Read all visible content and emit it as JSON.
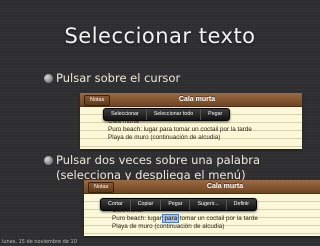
{
  "slide_title": "Seleccionar texto",
  "bullets": [
    {
      "text": "Pulsar sobre el cursor"
    },
    {
      "text": "Pulsar dos veces sobre una palabra (selecciona y despliega el menú)"
    }
  ],
  "screenshot1": {
    "notes_button": "Notas",
    "note_title": "Cala murta",
    "menu": [
      "Seleccionar",
      "Seleccionar todo",
      "Pegar"
    ],
    "lines": [
      "Cala murta",
      "Puro beach: lugar para tomar un coctail por la tarde",
      "Playa de muro (continuación de alcudia)"
    ]
  },
  "screenshot2": {
    "notes_button": "Notas",
    "note_title": "Cala murta",
    "menu": [
      "Cortar",
      "Copiar",
      "Pegar",
      "Sugerir...",
      "Definir"
    ],
    "lines": {
      "l1": "Cala murta",
      "l2_before": "Puro beach: lugar ",
      "l2_selected": "para",
      "l2_after": " tomar un coctail por la tarde",
      "l3": "Playa de muro (continuación de alcudia)"
    }
  },
  "footer_date": "lunes, 15 de noviembre de 10"
}
